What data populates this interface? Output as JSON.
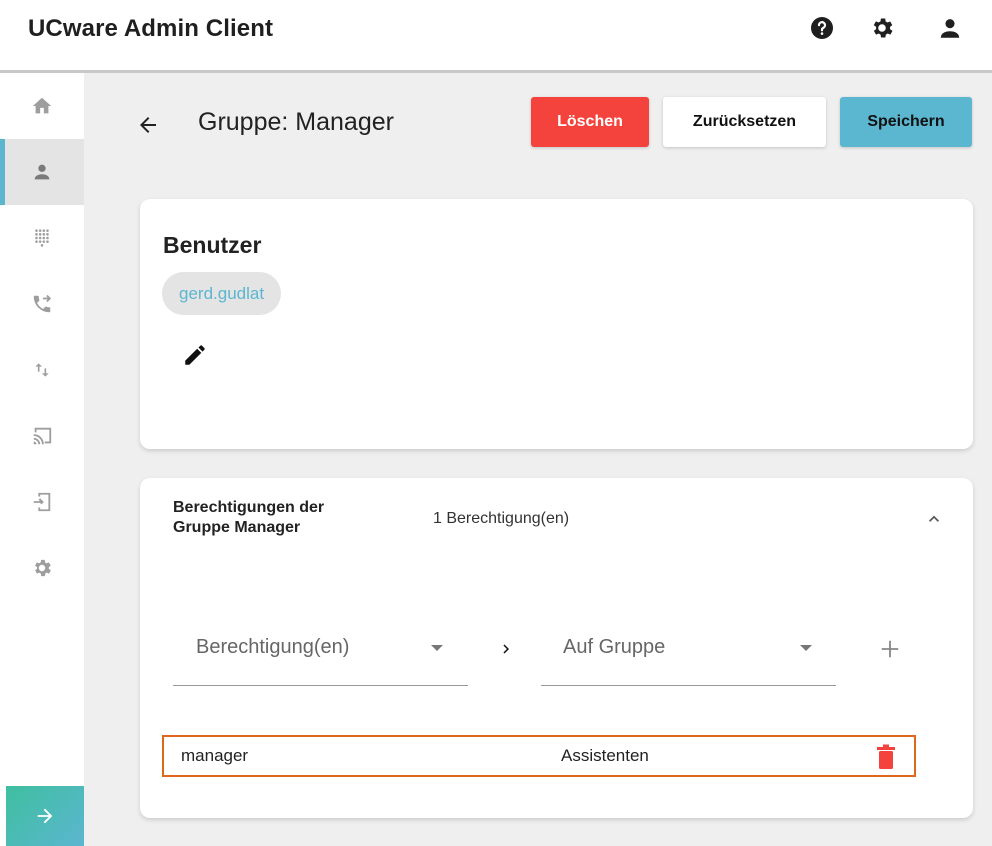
{
  "app": {
    "title": "UCware Admin Client"
  },
  "topbar": {
    "icons": [
      "help-icon",
      "settings-icon",
      "account-icon"
    ]
  },
  "sidebar": {
    "items": [
      {
        "icon": "home-icon",
        "active": false
      },
      {
        "icon": "user-icon",
        "active": true
      },
      {
        "icon": "dialpad-icon",
        "active": false
      },
      {
        "icon": "phone-forward-icon",
        "active": false
      },
      {
        "icon": "swap-vertical-icon",
        "active": false
      },
      {
        "icon": "cast-icon",
        "active": false
      },
      {
        "icon": "login-icon",
        "active": false
      },
      {
        "icon": "settings-icon",
        "active": false
      }
    ],
    "bottom_icon": "arrow-right-icon"
  },
  "header": {
    "title": "Gruppe: Manager",
    "delete_label": "Löschen",
    "reset_label": "Zurücksetzen",
    "save_label": "Speichern"
  },
  "users_card": {
    "title": "Benutzer",
    "chips": [
      "gerd.gudlat"
    ]
  },
  "permissions_card": {
    "title": "Berechtigungen der Gruppe Manager",
    "count": "1 Berechtigung(en)",
    "permission_select_placeholder": "Berechtigung(en)",
    "group_select_placeholder": "Auf Gruppe",
    "rows": [
      {
        "permission": "manager",
        "group": "Assistenten"
      }
    ]
  },
  "colors": {
    "accent": "#5bb6d0",
    "danger": "#f4433c",
    "highlight_border": "#e0661c",
    "chip_text": "#5bb6d0"
  }
}
